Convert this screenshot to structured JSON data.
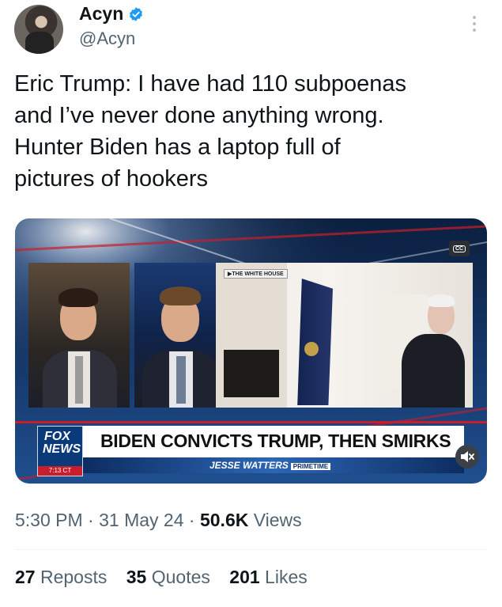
{
  "author": {
    "display_name": "Acyn",
    "handle": "@Acyn",
    "avatar_icon": "profile-avatar",
    "verified_icon": "verified-badge-icon",
    "verified_color": "#1d9bf0"
  },
  "tweet": {
    "lines": [
      "Eric Trump: I have had 110 subpoenas",
      "and I’ve never done anything wrong.",
      "Hunter Biden has a laptop full of",
      "pictures of hookers"
    ]
  },
  "video": {
    "cc_label": "CC",
    "location_tag": "▶THE WHITE HOUSE",
    "logo_line1": "FOX",
    "logo_line2": "NEWS",
    "logo_time": "7:13 CT",
    "headline": "BIDEN CONVICTS TRUMP, THEN SMIRKS",
    "show_name": "JESSE WATTERS",
    "show_suffix": "PRIMETIME",
    "mute_icon": "speaker-muted-icon",
    "accent_red": "#c81e2b",
    "accent_blue": "#0b3a7a"
  },
  "meta": {
    "time": "5:30 PM",
    "sep": " · ",
    "date": "31 May 24",
    "views_count": "50.6K",
    "views_label": "Views"
  },
  "stats": {
    "reposts_count": "27",
    "reposts_label": "Reposts",
    "quotes_count": "35",
    "quotes_label": "Quotes",
    "likes_count": "201",
    "likes_label": "Likes"
  },
  "menu_icon": "more-options-icon"
}
